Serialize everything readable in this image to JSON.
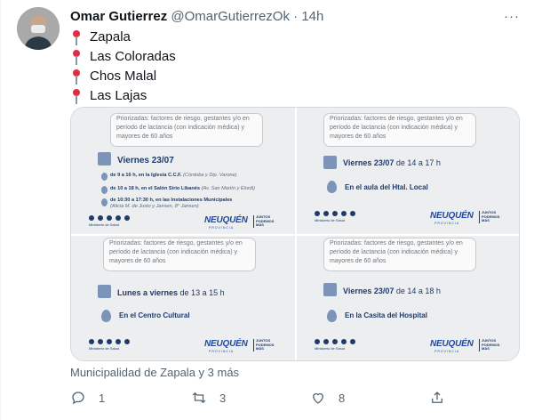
{
  "tweet": {
    "display_name": "Omar Gutierrez",
    "handle": "@OmarGutierrezOk",
    "separator": "·",
    "time": "14h",
    "more": "···",
    "lines": [
      "Zapala",
      "Las Coloradas",
      "Chos Malal",
      "Las Lajas"
    ],
    "line_icon": "round-pushpin-icon",
    "replies_text": "Municipalidad de Zapala y 3 más",
    "reply_count": "1",
    "retweet_count": "3",
    "like_count": "8"
  },
  "media": {
    "bubble_text": "Priorizadas: factores de riesgo, gestantes y/o en período de lactancia (con indicación médica) y mayores de 60 años",
    "ministerio": "Ministerio de Salud",
    "brand": "NEUQUÉN",
    "brand_sub": "PROVINCIA",
    "juntos": "JUNTOS PODEMOS MÁS",
    "card1": {
      "day": "Viernes 23/07",
      "items": [
        {
          "bold": "de 9 a 16 h, en la Iglesia C.C.F.",
          "note": "(Córdoba y Dip. Varone)"
        },
        {
          "bold": "de 10 a 18 h, en el Salón Sirio Libanés",
          "note": "(Av. San Martín y Elordi)"
        },
        {
          "bold": "de 10:30 a 17:30 h, en las Instalaciones Municipales",
          "note": "(Alicia M. de Justo y Jansen, 8° Jansen)"
        }
      ]
    },
    "card2": {
      "day": "Viernes 23/07",
      "time": " de 14 a 17 h",
      "place": "En el  aula del Htal. Local"
    },
    "card3": {
      "day": "Lunes a viernes",
      "time": " de 13 a 15 h",
      "place": "En el Centro Cultural"
    },
    "card4": {
      "day": "Viernes 23/07",
      "time": " de 14 a 18 h",
      "place": "En la Casita del Hospital"
    }
  },
  "colors": {
    "pin": "#dd2e44",
    "navy": "#1e3a6b",
    "brand_blue": "#1f4aa3",
    "muted": "#536471"
  }
}
